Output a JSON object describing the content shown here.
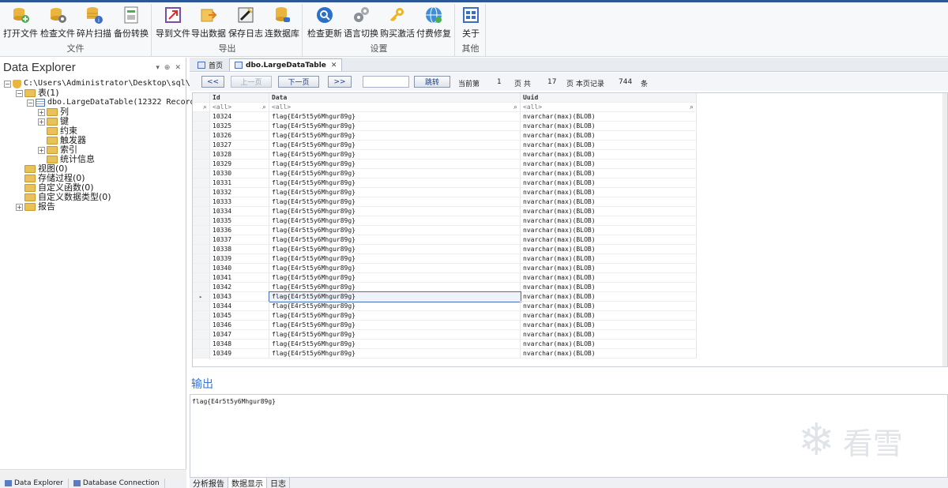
{
  "ribbon": {
    "groups": [
      {
        "caption": "文件",
        "buttons": [
          {
            "label": "打开文件",
            "icon": "open-db-icon"
          },
          {
            "label": "检查文件",
            "icon": "check-db-icon"
          },
          {
            "label": "碎片扫描",
            "icon": "scan-db-icon"
          },
          {
            "label": "备份转换",
            "icon": "backup-icon"
          }
        ]
      },
      {
        "caption": "导出",
        "buttons": [
          {
            "label": "导到文件",
            "icon": "export-file-icon"
          },
          {
            "label": "导出数据",
            "icon": "export-data-icon"
          },
          {
            "label": "保存日志",
            "icon": "save-log-icon"
          },
          {
            "label": "连数据库",
            "icon": "connect-db-icon"
          }
        ]
      },
      {
        "caption": "设置",
        "buttons": [
          {
            "label": "检查更新",
            "icon": "update-icon"
          },
          {
            "label": "语言切换",
            "icon": "gears-icon"
          },
          {
            "label": "购买激活",
            "icon": "key-icon"
          },
          {
            "label": "付费修复",
            "icon": "globe-icon"
          }
        ]
      },
      {
        "caption": "其他",
        "buttons": [
          {
            "label": "关于",
            "icon": "about-icon"
          }
        ]
      }
    ]
  },
  "explorer": {
    "title": "Data Explorer",
    "controls": [
      "▾",
      "⊕",
      "✕"
    ],
    "tree": {
      "root": "C:\\Users\\Administrator\\Desktop\\sql\\Lar",
      "tables": "表(1)",
      "table_name": "dbo.LargeDataTable(12322 Records)",
      "columns": "列",
      "keys": "键",
      "constraints": "约束",
      "triggers": "触发器",
      "indexes": "索引",
      "stats": "统计信息",
      "views": "视图(0)",
      "procs": "存储过程(0)",
      "funcs": "自定义函数(0)",
      "types": "自定义数据类型(0)",
      "reports": "报告"
    },
    "bottom_tabs": [
      "Data Explorer",
      "Database Connection"
    ]
  },
  "doc_tabs": [
    {
      "label": "首页",
      "active": false
    },
    {
      "label": "dbo.LargeDataTable",
      "active": true,
      "close": "✕"
    }
  ],
  "pager": {
    "first": "<<",
    "prev": "上一页",
    "next": "下一页",
    "last": ">>",
    "goto": "跳转",
    "current_label": "当前第",
    "current_page": "1",
    "page_word": "页 共",
    "total_pages": "17",
    "per_page_label": "页 本页记录",
    "record_count": "744",
    "unit": "条"
  },
  "grid": {
    "columns": [
      "Id",
      "Data",
      "Uuid"
    ],
    "filter_placeholder": "<all>",
    "selected_row_index": 19,
    "row_marker": "▸",
    "rows": [
      [
        "10324",
        "flag{E4r5t5y6Mhgur89g}",
        "nvarchar(max)(BLOB)"
      ],
      [
        "10325",
        "flag{E4r5t5y6Mhgur89g}",
        "nvarchar(max)(BLOB)"
      ],
      [
        "10326",
        "flag{E4r5t5y6Mhgur89g}",
        "nvarchar(max)(BLOB)"
      ],
      [
        "10327",
        "flag{E4r5t5y6Mhgur89g}",
        "nvarchar(max)(BLOB)"
      ],
      [
        "10328",
        "flag{E4r5t5y6Mhgur89g}",
        "nvarchar(max)(BLOB)"
      ],
      [
        "10329",
        "flag{E4r5t5y6Mhgur89g}",
        "nvarchar(max)(BLOB)"
      ],
      [
        "10330",
        "flag{E4r5t5y6Mhgur89g}",
        "nvarchar(max)(BLOB)"
      ],
      [
        "10331",
        "flag{E4r5t5y6Mhgur89g}",
        "nvarchar(max)(BLOB)"
      ],
      [
        "10332",
        "flag{E4r5t5y6Mhgur89g}",
        "nvarchar(max)(BLOB)"
      ],
      [
        "10333",
        "flag{E4r5t5y6Mhgur89g}",
        "nvarchar(max)(BLOB)"
      ],
      [
        "10334",
        "flag{E4r5t5y6Mhgur89g}",
        "nvarchar(max)(BLOB)"
      ],
      [
        "10335",
        "flag{E4r5t5y6Mhgur89g}",
        "nvarchar(max)(BLOB)"
      ],
      [
        "10336",
        "flag{E4r5t5y6Mhgur89g}",
        "nvarchar(max)(BLOB)"
      ],
      [
        "10337",
        "flag{E4r5t5y6Mhgur89g}",
        "nvarchar(max)(BLOB)"
      ],
      [
        "10338",
        "flag{E4r5t5y6Mhgur89g}",
        "nvarchar(max)(BLOB)"
      ],
      [
        "10339",
        "flag{E4r5t5y6Mhgur89g}",
        "nvarchar(max)(BLOB)"
      ],
      [
        "10340",
        "flag{E4r5t5y6Mhgur89g}",
        "nvarchar(max)(BLOB)"
      ],
      [
        "10341",
        "flag{E4r5t5y6Mhgur89g}",
        "nvarchar(max)(BLOB)"
      ],
      [
        "10342",
        "flag{E4r5t5y6Mhgur89g}",
        "nvarchar(max)(BLOB)"
      ],
      [
        "10343",
        "flag{E4r5t5y6Mhgur89g}",
        "nvarchar(max)(BLOB)"
      ],
      [
        "10344",
        "flag{E4r5t5y6Mhgur89g}",
        "nvarchar(max)(BLOB)"
      ],
      [
        "10345",
        "flag{E4r5t5y6Mhgur89g}",
        "nvarchar(max)(BLOB)"
      ],
      [
        "10346",
        "flag{E4r5t5y6Mhgur89g}",
        "nvarchar(max)(BLOB)"
      ],
      [
        "10347",
        "flag{E4r5t5y6Mhgur89g}",
        "nvarchar(max)(BLOB)"
      ],
      [
        "10348",
        "flag{E4r5t5y6Mhgur89g}",
        "nvarchar(max)(BLOB)"
      ],
      [
        "10349",
        "flag{E4r5t5y6Mhgur89g}",
        "nvarchar(max)(BLOB)"
      ]
    ]
  },
  "output": {
    "title": "输出",
    "text": "flag{E4r5t5y6Mhgur89g}"
  },
  "bottom_tabs": [
    "分析报告",
    "数据显示",
    "日志"
  ],
  "watermark": {
    "text": "看雪",
    "glyph": "❄"
  }
}
